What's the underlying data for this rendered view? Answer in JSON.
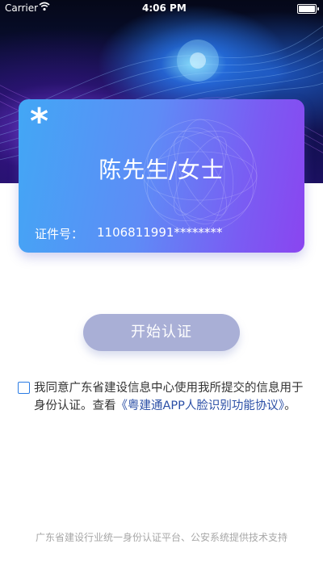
{
  "status_bar": {
    "carrier": "Carrier",
    "time": "4:06 PM",
    "wifi_icon": "wifi-icon",
    "battery_icon": "battery-icon"
  },
  "card": {
    "symbol": "*",
    "name": "陈先生/女士",
    "id_label": "证件号：",
    "id_value": "1106811991********",
    "gradient_start": "#42a7f5",
    "gradient_end": "#8a45f0"
  },
  "start_button": {
    "label": "开始认证",
    "color": "#a9afd6"
  },
  "agreement": {
    "checked": false,
    "text_before": "我同意广东省建设信息中心使用我所提交的信息用于身份认证。查看",
    "link_text": "《粤建通APP人脸识别功能协议》",
    "text_after": "。",
    "link_color": "#2b4fa6",
    "checkbox_color": "#2a7be4"
  },
  "footer": {
    "text": "广东省建设行业统一身份认证平台、公安系统提供技术支持"
  }
}
